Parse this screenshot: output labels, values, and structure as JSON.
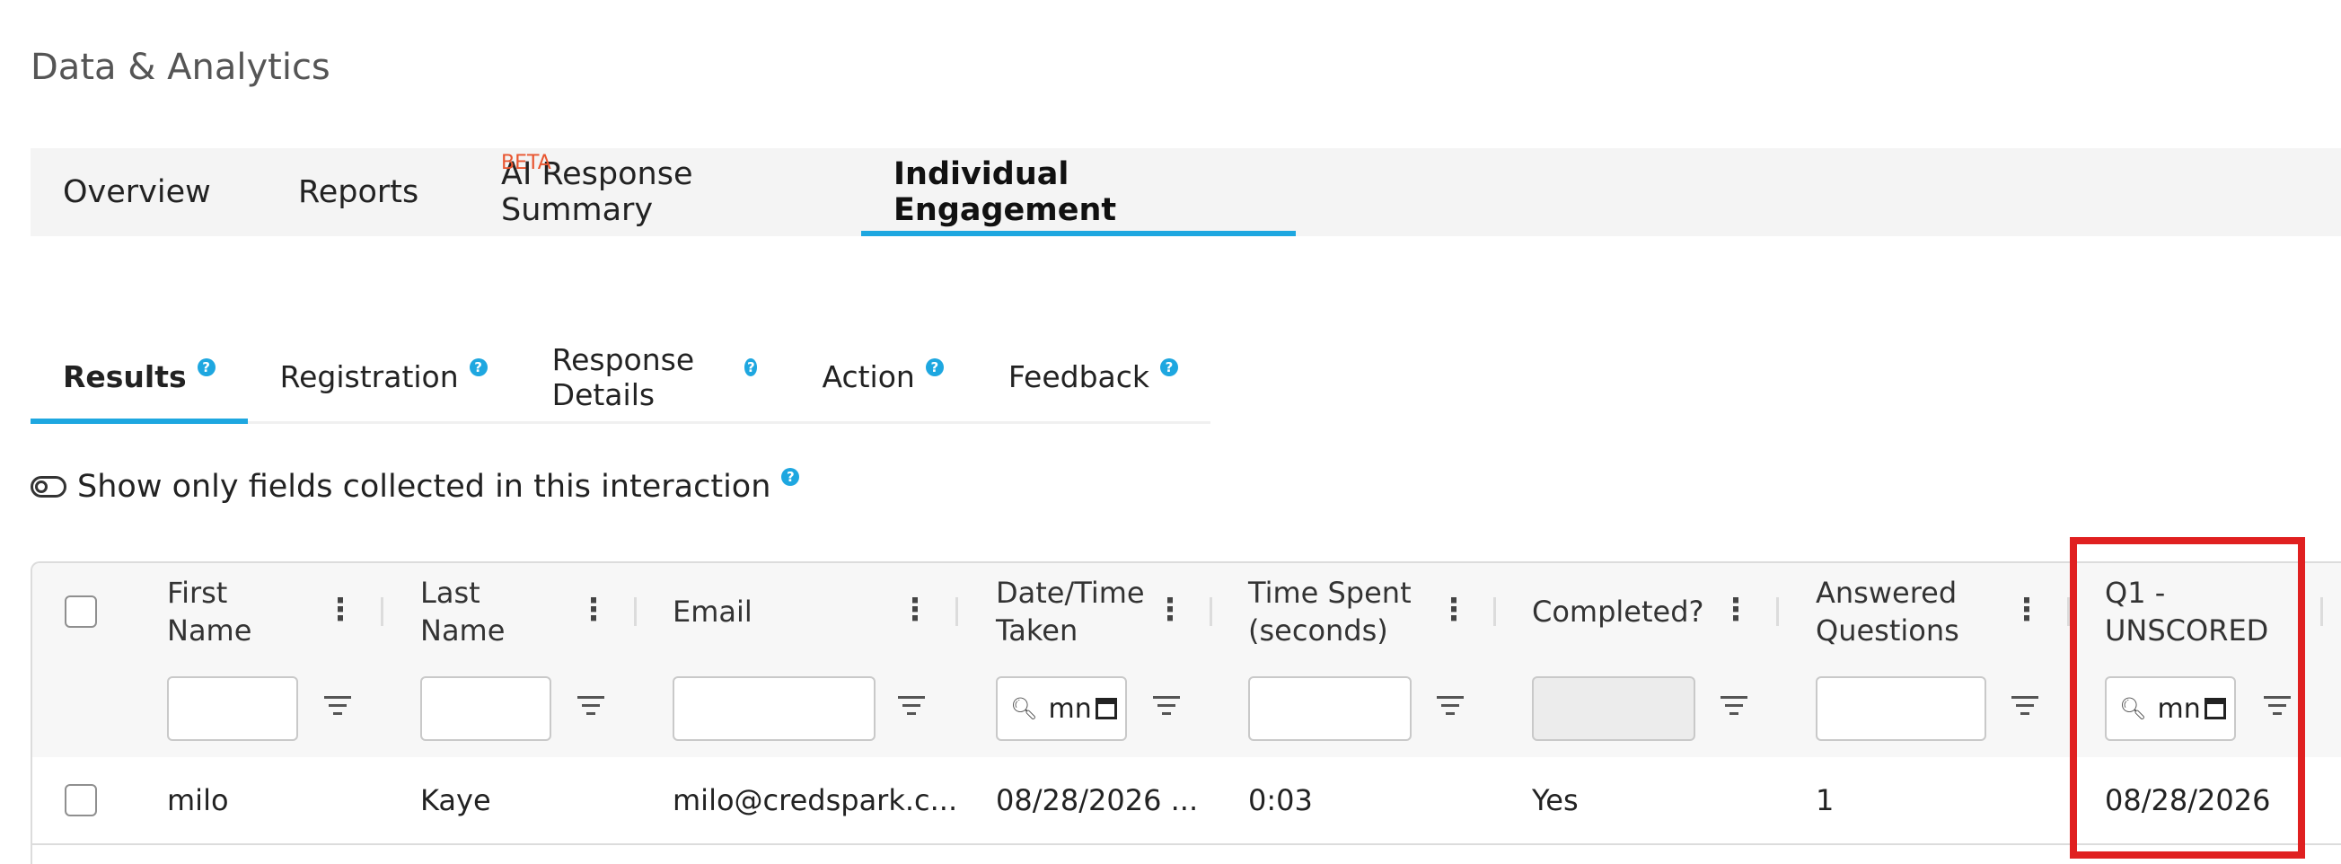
{
  "page": {
    "title": "Data & Analytics"
  },
  "top_tabs": [
    {
      "label": "Overview"
    },
    {
      "label": "Reports"
    },
    {
      "label": "AI Response Summary",
      "badge": "BETA"
    },
    {
      "label": "Individual Engagement",
      "active": true
    }
  ],
  "sub_tabs": [
    {
      "label": "Results",
      "active": true,
      "help": "?"
    },
    {
      "label": "Registration",
      "help": "?"
    },
    {
      "label": "Response Details",
      "help": "?"
    },
    {
      "label": "Action",
      "help": "?"
    },
    {
      "label": "Feedback",
      "help": "?"
    }
  ],
  "toggle": {
    "label": "Show only fields collected in this interaction",
    "help": "?"
  },
  "table": {
    "columns": [
      {
        "line1": "First",
        "line2": "Name"
      },
      {
        "line1": "Last",
        "line2": "Name"
      },
      {
        "line1": "Email",
        "line2": ""
      },
      {
        "line1": "Date/Time",
        "line2": "Taken"
      },
      {
        "line1": "Time Spent",
        "line2": "(seconds)"
      },
      {
        "line1": "Completed?",
        "line2": ""
      },
      {
        "line1": "Answered",
        "line2": "Questions"
      },
      {
        "line1": "Q1 -",
        "line2": "UNSCORED"
      }
    ],
    "date_filter_value": "mn",
    "rows": [
      {
        "first_name": "milo",
        "last_name": "Kaye",
        "email": "milo@credspark.c...",
        "date_taken": "08/28/2026 ...",
        "time_spent": "0:03",
        "completed": "Yes",
        "answered": "1",
        "q1": "08/28/2026"
      }
    ]
  },
  "icons": {
    "kebab": "⋮",
    "search": "🔍︎",
    "highlight_color": "#e02020",
    "accent_color": "#1ea7e0",
    "beta_color": "#e8552f"
  }
}
